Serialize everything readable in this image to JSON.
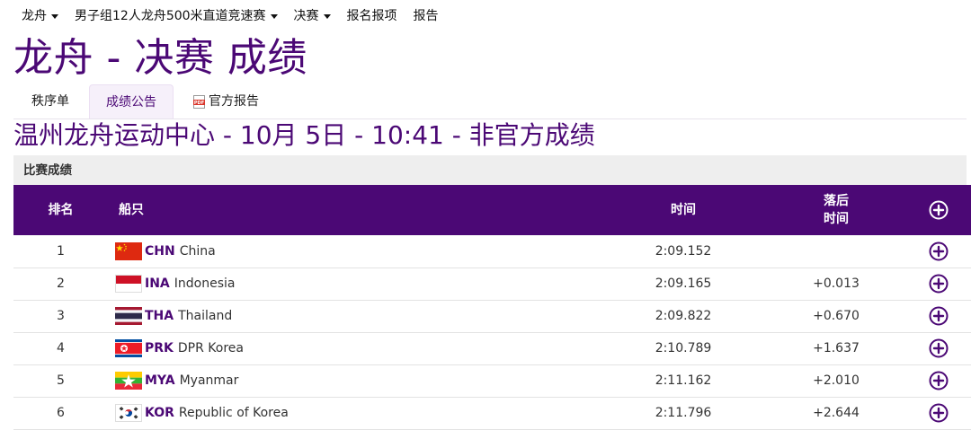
{
  "nav": {
    "items": [
      {
        "label": "龙舟",
        "dropdown": true
      },
      {
        "label": "男子组12人龙舟500米直道竞速赛",
        "dropdown": true
      },
      {
        "label": "决赛",
        "dropdown": true
      },
      {
        "label": "报名报项",
        "dropdown": false
      },
      {
        "label": "报告",
        "dropdown": false
      }
    ]
  },
  "page": {
    "title": "龙舟 - 决赛 成绩",
    "subtitle": "温州龙舟运动中心 - 10月 5日 - 10:41 - 非官方成绩"
  },
  "tabs": [
    {
      "label": "秩序单",
      "active": false
    },
    {
      "label": "成绩公告",
      "active": true
    },
    {
      "label": "官方报告",
      "active": false,
      "icon": "pdf-icon"
    }
  ],
  "section": {
    "label": "比赛成绩"
  },
  "table": {
    "headers": {
      "rank": "排名",
      "boat": "船只",
      "time": "时间",
      "behind_line1": "落后",
      "behind_line2": "时间",
      "expand_icon": "plus-circle-icon"
    },
    "rows": [
      {
        "rank": "1",
        "code": "CHN",
        "country": "China",
        "time": "2:09.152",
        "behind": "",
        "flag": "china-flag"
      },
      {
        "rank": "2",
        "code": "INA",
        "country": "Indonesia",
        "time": "2:09.165",
        "behind": "+0.013",
        "flag": "indonesia-flag"
      },
      {
        "rank": "3",
        "code": "THA",
        "country": "Thailand",
        "time": "2:09.822",
        "behind": "+0.670",
        "flag": "thailand-flag"
      },
      {
        "rank": "4",
        "code": "PRK",
        "country": "DPR Korea",
        "time": "2:10.789",
        "behind": "+1.637",
        "flag": "dpr-korea-flag"
      },
      {
        "rank": "5",
        "code": "MYA",
        "country": "Myanmar",
        "time": "2:11.162",
        "behind": "+2.010",
        "flag": "myanmar-flag"
      },
      {
        "rank": "6",
        "code": "KOR",
        "country": "Republic of Korea",
        "time": "2:11.796",
        "behind": "+2.644",
        "flag": "korea-flag"
      }
    ]
  },
  "colors": {
    "brand": "#4b0875",
    "row_border": "#e3e3e3",
    "section_bg": "#eeeeee"
  }
}
